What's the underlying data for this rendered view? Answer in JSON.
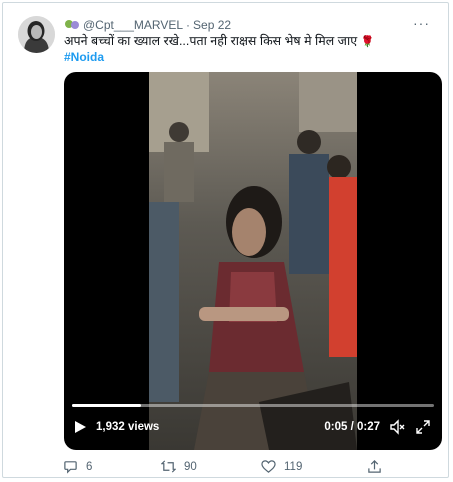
{
  "tweet": {
    "handle": "@Cpt___MARVEL",
    "separator": "·",
    "date": "Sep 22",
    "more_label": "···",
    "text": "अपने बच्चों का ख्याल रखे...पता नही राक्षस किस  भेष मे मिल जाए",
    "rose": "🌹",
    "hashtag": "#Noida"
  },
  "video": {
    "views": "1,932 views",
    "time": "0:05 / 0:27",
    "progress": 0.19
  },
  "actions": {
    "replies": "6",
    "retweets": "90",
    "likes": "119"
  },
  "colors": {
    "accent": "#1d9bf0",
    "muted": "#536471"
  },
  "icons": [
    "avatar-photo",
    "emoji-icon",
    "more-icon",
    "play-icon",
    "mute-icon",
    "fullscreen-icon",
    "reply-icon",
    "retweet-icon",
    "like-icon",
    "share-icon"
  ]
}
